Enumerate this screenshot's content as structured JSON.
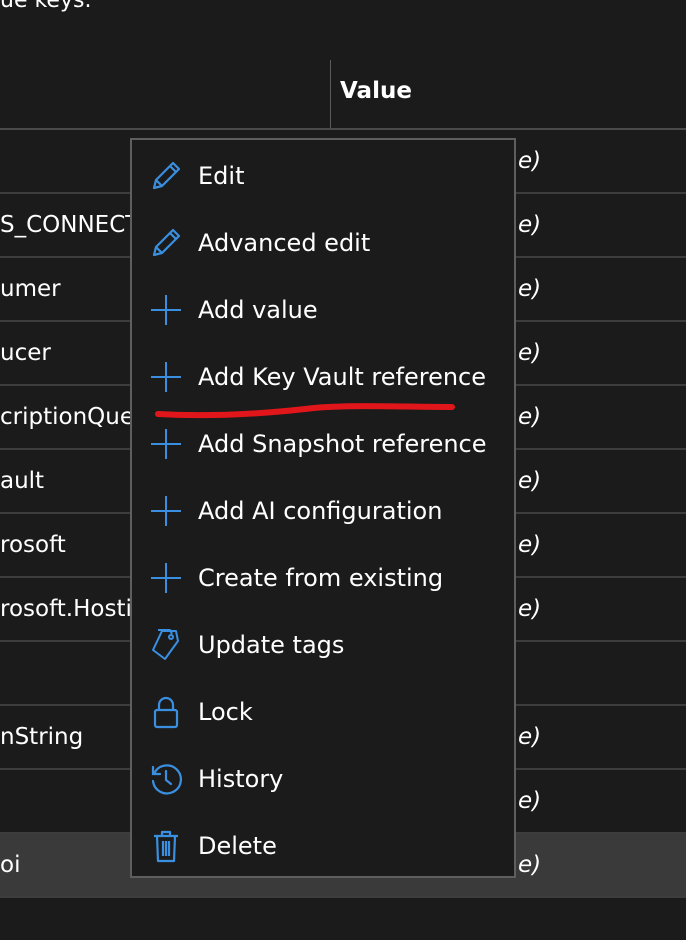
{
  "page": {
    "top_text": "ue keys."
  },
  "table": {
    "header_value": "Value",
    "rows": [
      {
        "name": "",
        "value": "e)"
      },
      {
        "name": "S_CONNECT",
        "value": "e)"
      },
      {
        "name": "umer",
        "value": "e)"
      },
      {
        "name": "ucer",
        "value": "e)"
      },
      {
        "name": "criptionQue",
        "value": "e)"
      },
      {
        "name": "ault",
        "value": "e)"
      },
      {
        "name": "rosoft",
        "value": "e)"
      },
      {
        "name": "rosoft.Hosti",
        "value": "e)"
      },
      {
        "name": "",
        "value": ""
      },
      {
        "name": "nString",
        "value": "e)"
      },
      {
        "name": "",
        "value": "e)"
      },
      {
        "name": "oi",
        "value": "e)"
      }
    ]
  },
  "context_menu": {
    "items": [
      {
        "label": "Edit",
        "icon": "pencil-icon"
      },
      {
        "label": "Advanced edit",
        "icon": "pencil-icon"
      },
      {
        "label": "Add value",
        "icon": "plus-icon"
      },
      {
        "label": "Add Key Vault reference",
        "icon": "plus-icon"
      },
      {
        "label": "Add Snapshot reference",
        "icon": "plus-icon"
      },
      {
        "label": "Add AI configuration",
        "icon": "plus-icon"
      },
      {
        "label": "Create from existing",
        "icon": "plus-icon"
      },
      {
        "label": "Update tags",
        "icon": "tags-icon"
      },
      {
        "label": "Lock",
        "icon": "lock-icon"
      },
      {
        "label": "History",
        "icon": "history-icon"
      },
      {
        "label": "Delete",
        "icon": "trash-icon"
      }
    ]
  },
  "colors": {
    "background": "#1b1b1b",
    "accent_icon": "#3a8fe0",
    "annotation_red": "#e0161b",
    "selected_row": "#3a3a3a"
  }
}
